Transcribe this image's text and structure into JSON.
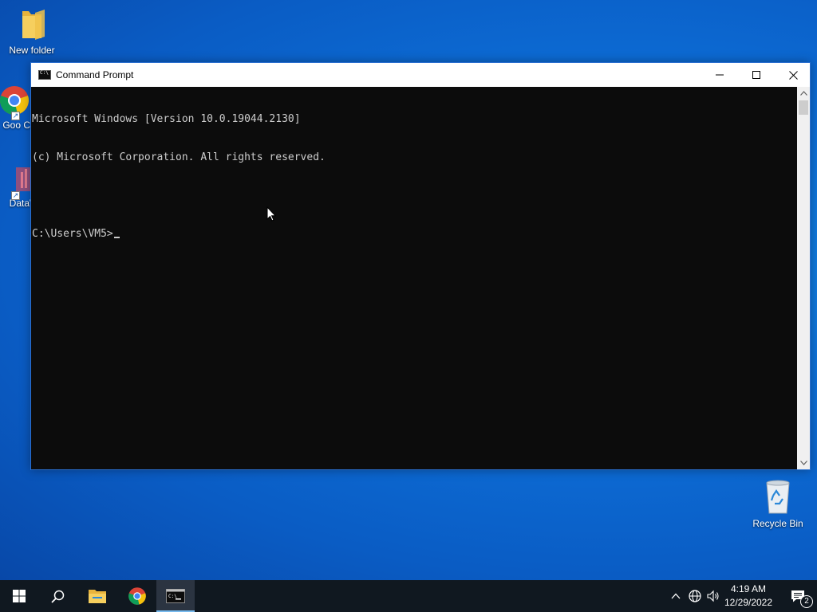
{
  "desktop": {
    "icons": [
      {
        "label": "New folder",
        "icon": "folder-icon"
      },
      {
        "label": "Goo Chr",
        "icon": "chrome-icon"
      },
      {
        "label": "DataW",
        "icon": "datawrapper-icon"
      },
      {
        "label": "Recycle Bin",
        "icon": "recycle-bin-icon"
      }
    ]
  },
  "window": {
    "title": "Command Prompt",
    "icon": "cmd-icon",
    "controls": [
      "minimize-icon",
      "maximize-icon",
      "close-icon"
    ],
    "console": {
      "lines": [
        "Microsoft Windows [Version 10.0.19044.2130]",
        "(c) Microsoft Corporation. All rights reserved.",
        "",
        "C:\\Users\\VM5>"
      ]
    }
  },
  "taskbar": {
    "items": [
      {
        "icon": "windows-start-icon"
      },
      {
        "icon": "search-icon"
      },
      {
        "icon": "file-explorer-icon"
      },
      {
        "icon": "chrome-icon"
      },
      {
        "icon": "cmd-icon",
        "active": true
      }
    ],
    "tray": {
      "icons": [
        "chevron-up-icon",
        "network-icon",
        "volume-icon"
      ],
      "time": "4:19 AM",
      "date": "12/29/2022",
      "notifications_count": "2"
    }
  },
  "colors": {
    "desktop_blue": "#0d6fd8",
    "console_bg": "#0c0c0c",
    "console_text": "#cccccc",
    "taskbar_bg": "#101820",
    "taskbar_active_accent": "#76b9ed"
  }
}
